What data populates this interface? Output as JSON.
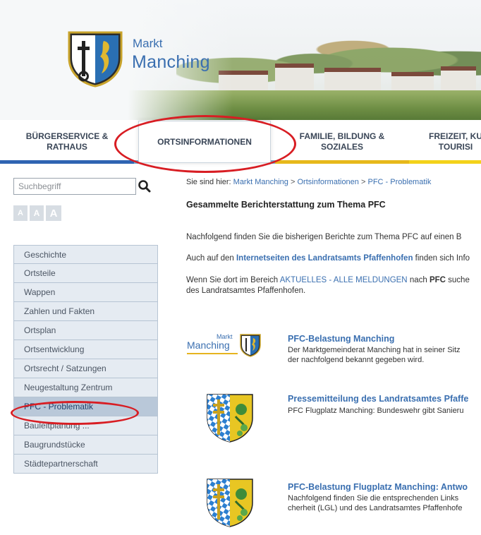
{
  "header": {
    "brand_small": "Markt",
    "brand_big": "Manching"
  },
  "nav": {
    "items": [
      {
        "label": "BÜRGERSERVICE &\nRATHAUS",
        "bar_color": "#2f64b2"
      },
      {
        "label": "ORTSINFORMATIONEN",
        "bar_color": "#6fa9cf",
        "active": true
      },
      {
        "label": "FAMILIE, BILDUNG &\nSOZIALES",
        "bar_color": "#e7b81b"
      },
      {
        "label": "FREIZEIT, KU\nTOURISI",
        "bar_color": "#f3d21a"
      }
    ]
  },
  "sidebar": {
    "search_placeholder": "Suchbegriff",
    "font_sizes": [
      "A",
      "A",
      "A"
    ],
    "items": [
      {
        "label": "Geschichte"
      },
      {
        "label": "Ortsteile"
      },
      {
        "label": "Wappen"
      },
      {
        "label": "Zahlen und Fakten"
      },
      {
        "label": "Ortsplan"
      },
      {
        "label": "Ortsentwicklung"
      },
      {
        "label": "Ortsrecht / Satzungen"
      },
      {
        "label": "Neugestaltung Zentrum"
      },
      {
        "label": "PFC - Problematik",
        "active": true
      },
      {
        "label": "Bauleitplanung ..."
      },
      {
        "label": "Baugrundstücke"
      },
      {
        "label": "Städtepartnerschaft"
      }
    ]
  },
  "breadcrumb": {
    "prefix": "Sie sind hier:",
    "items": [
      "Markt Manching",
      "Ortsinformationen",
      "PFC - Problematik"
    ],
    "separator": ">"
  },
  "main": {
    "title": "Gesammelte Berichterstattung zum Thema PFC",
    "p1": "Nachfolgend finden Sie die bisherigen Berichte zum Thema PFC auf einen B",
    "p2_pre": "Auch auf den ",
    "p2_link": "Internetseiten des Landratsamts Pfaffenhofen",
    "p2_post": " finden sich Info",
    "p3_pre": "Wenn Sie dort im Bereich ",
    "p3_link": "AKTUELLES - ALLE MELDUNGEN",
    "p3_mid": " nach ",
    "p3_bold": "PFC",
    "p3_post": " suche",
    "p3_line2": "des Landratsamtes Pfaffenhofen.",
    "entries": [
      {
        "title": "PFC-Belastung Manching",
        "lines": [
          "Der Marktgemeinderat Manching hat in seiner Sitz",
          "der nachfolgend bekannt gegeben wird."
        ],
        "thumb_brand_small": "Markt",
        "thumb_brand_big": "Manching"
      },
      {
        "title": "Pressemitteilung des Landratsamtes Pfaffe",
        "lines": [
          "PFC Flugplatz Manching: Bundeswehr gibt Sanieru"
        ]
      },
      {
        "title": "PFC-Belastung Flugplatz Manching: Antwo",
        "lines": [
          "Nachfolgend finden Sie die entsprechenden Links",
          "cherheit (LGL) und des Landratsamtes Pfaffenhofe"
        ]
      }
    ]
  },
  "colors": {
    "accent_blue": "#3a6fb0",
    "annotation_red": "#d81d23",
    "sidebar_bg": "#e5ebf2",
    "sidebar_active": "#b9c8d9"
  }
}
